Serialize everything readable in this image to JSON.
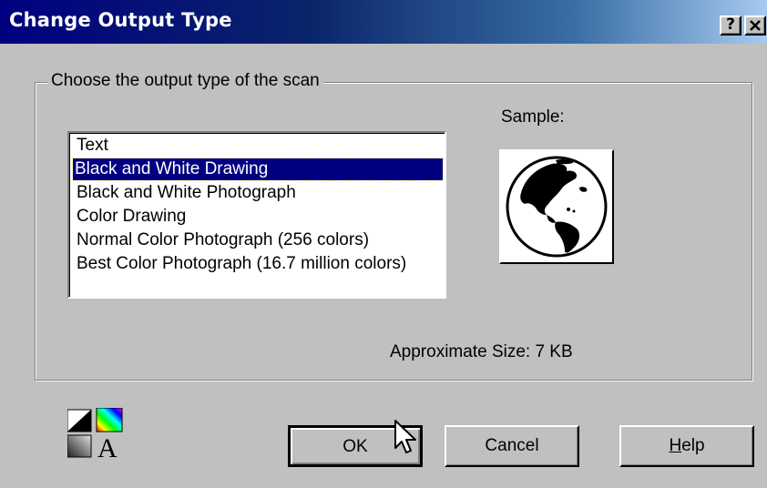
{
  "window": {
    "title": "Change Output Type",
    "help_button": "?",
    "close_button": "✕"
  },
  "group": {
    "legend": "Choose the output type of the scan",
    "sample_label": "Sample:",
    "approx_size": "Approximate Size: 7 KB"
  },
  "list": {
    "items": [
      {
        "label": "Text",
        "selected": false
      },
      {
        "label": "Black and White Drawing",
        "selected": true
      },
      {
        "label": "Black and White Photograph",
        "selected": false
      },
      {
        "label": "Color Drawing",
        "selected": false
      },
      {
        "label": "Normal Color Photograph (256 colors)",
        "selected": false
      },
      {
        "label": "Best Color Photograph (16.7 million colors)",
        "selected": false
      }
    ]
  },
  "buttons": {
    "ok": "OK",
    "cancel": "Cancel",
    "help_prefix": "H",
    "help_rest": "elp"
  },
  "icons": {
    "sample": "globe-icon",
    "output_type": "output-type-icon",
    "cursor": "mouse-cursor-icon"
  },
  "colors": {
    "title_start": "#000080",
    "title_end": "#a6caf0",
    "selection": "#000080",
    "face": "#c0c0c0"
  }
}
